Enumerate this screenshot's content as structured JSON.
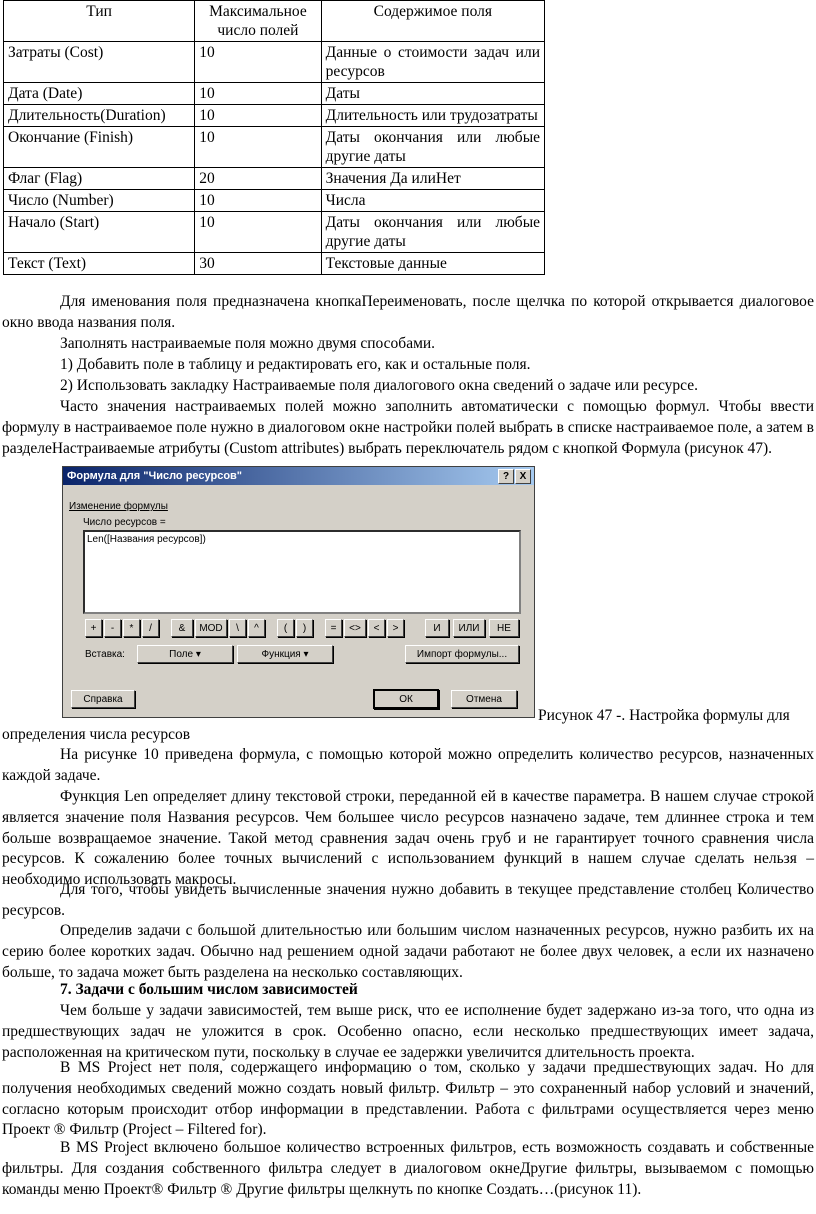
{
  "table": {
    "headers": [
      "Тип",
      "Максимальное число полей",
      "Содержимое поля"
    ],
    "rows": [
      [
        "Затраты (Cost)",
        "10",
        "Данные о стоимости задач или ресурсов"
      ],
      [
        "Дата (Date)",
        "10",
        "Даты"
      ],
      [
        "Длительность(Duration)",
        "10",
        "Длительность или трудозатраты"
      ],
      [
        "Окончание (Finish)",
        "10",
        "Даты окончания или любые другие даты"
      ],
      [
        "Флаг (Flag)",
        "20",
        "Значения Да илиНет"
      ],
      [
        "Число (Number)",
        "10",
        "Числа"
      ],
      [
        "Начало (Start)",
        "10",
        "Даты окончания или любые другие даты"
      ],
      [
        "Текст (Text)",
        "30",
        "Текстовые данные"
      ]
    ]
  },
  "para1": "Для именования поля предназначена кнопкаПереименовать, после щелчка по которой открывается диалоговое окно ввода названия поля.",
  "para2": "Заполнять настраиваемые поля можно двумя способами.",
  "para3": "1) Добавить поле в таблицу и редактировать его, как и остальные поля.",
  "para4": "2) Использовать закладку Настраиваемые поля диалогового окна сведений о задаче или ресурсе.",
  "para5": "Часто значения настраиваемых полей можно заполнить автоматически с помощью формул. Чтобы ввести формулу в настраиваемое поле нужно в диалоговом окне настройки полей выбрать в списке настраиваемое поле, а затем в разделеНастраиваемые атрибуты (Custom attributes) выбрать переключатель рядом с кнопкой Формула (рисунок 47).",
  "dialog": {
    "title": "Формула для \"Число ресурсов\"",
    "help_btn": "?",
    "close_btn": "X",
    "section": "Изменение формулы",
    "field_label": "Число ресурсов =",
    "formula": "Len([Названия ресурсов])",
    "ops": [
      "+",
      "-",
      "*",
      "/",
      "&",
      "MOD",
      "\\",
      "^",
      "(",
      ")",
      "=",
      "<>",
      "<",
      ">",
      "И",
      "ИЛИ",
      "НЕ"
    ],
    "insert_label": "Вставка:",
    "field_btn": "Поле ▾",
    "function_btn": "Функция ▾",
    "import_btn": "Импорт формулы...",
    "help_button": "Справка",
    "ok_button": "ОК",
    "cancel_button": "Отмена"
  },
  "caption": "Рисунок 47 -. Настройка формулы для",
  "caption_cont": "определения числа ресурсов",
  "para6": "На рисунке 10 приведена формула, с помощью которой можно определить количество ресурсов, назначенных каждой задаче.",
  "para7": "Функция Len определяет длину текстовой строки, переданной ей в качестве параметра. В нашем случае строкой является значение поля Названия ресурсов. Чем большее число ресурсов назначено задаче, тем длиннее строка и тем больше возвращаемое значение. Такой метод сравнения задач очень груб и не гарантирует точного сравнения числа ресурсов. К сожалению более точных вычислений с использованием функций в нашем случае сделать нельзя – необходимо использовать макросы.",
  "para8": "Для того, чтобы увидеть вычисленные значения нужно добавить в текущее представление столбец Количество ресурсов.",
  "para9": "Определив задачи с большой длительностью или большим числом назначенных ресурсов, нужно разбить их на серию более коротких задач. Обычно над решением одной задачи работают не более двух человек, а если их назначено больше, то задача может быть разделена на несколько составляющих.",
  "heading7": "7. Задачи с большим числом зависимостей",
  "para10": "Чем больше у задачи зависимостей, тем выше риск, что ее исполнение будет задержано из-за того, что одна из предшествующих задач не уложится в срок. Особенно опасно, если несколько предшествующих имеет задача, расположенная на критическом пути, поскольку в случае ее задержки увеличится длительность проекта.",
  "para11": "В MS Project нет поля, содержащего информацию о том, сколько у задачи предшествующих задач. Но для получения необходимых сведений можно создать новый фильтр. Фильтр – это сохраненный набор условий и значений, согласно которым происходит отбор информации в представлении. Работа с фильтрами осуществляется через меню Проект ® Фильтр (Project – Filtered for).",
  "para12": "В MS Project включено большое количество встроенных фильтров, есть возможность создавать и собственные фильтры. Для создания собственного фильтра следует в диалоговом окнеДругие фильтры, вызываемом с помощью команды меню Проект® Фильтр ® Другие фильтры щелкнуть по кнопке Создать…(рисунок 11)."
}
